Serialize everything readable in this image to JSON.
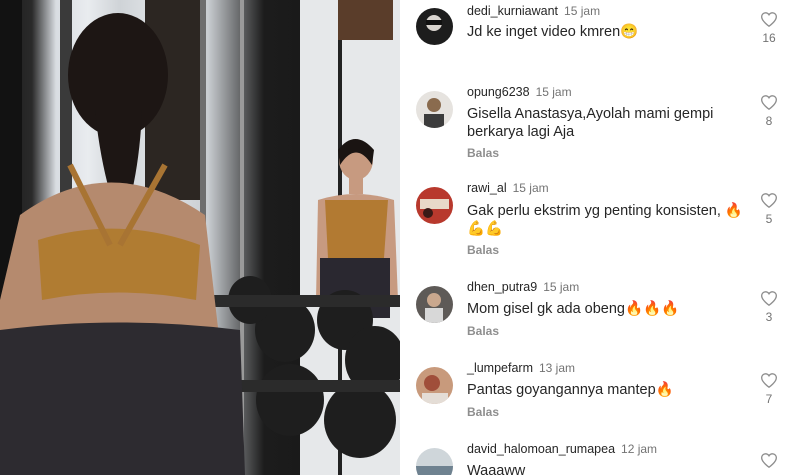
{
  "photo": {
    "description_icon": "gym-mirror-photo"
  },
  "comments": [
    {
      "username": "dedi_kurniawant",
      "time": "15 jam",
      "text": "Jd ke inget video kmren😁",
      "reply": "",
      "likes": "16",
      "avatar_color": "#1d1d1d"
    },
    {
      "username": "opung6238",
      "time": "15 jam",
      "text": "Gisella Anastasya,Ayolah mami gempi berkarya lagi Aja",
      "reply": "Balas",
      "likes": "8",
      "avatar_color": "#8a6b4e"
    },
    {
      "username": "rawi_al",
      "time": "15 jam",
      "text": "Gak perlu ekstrim yg penting konsisten, 🔥💪💪",
      "reply": "Balas",
      "likes": "5",
      "avatar_color": "#b8392d"
    },
    {
      "username": "dhen_putra9",
      "time": "15 jam",
      "text": "Mom gisel gk ada obeng🔥🔥🔥",
      "reply": "Balas",
      "likes": "3",
      "avatar_color": "#5e5a57"
    },
    {
      "username": "_lumpefarm",
      "time": "13 jam",
      "text": "Pantas goyangannya mantep🔥",
      "reply": "Balas",
      "likes": "7",
      "avatar_color": "#c89a7c"
    },
    {
      "username": "david_halomoan_rumapea",
      "time": "12 jam",
      "text": "Waaaww",
      "reply": "",
      "likes": "",
      "avatar_color": "#6f8290"
    }
  ]
}
